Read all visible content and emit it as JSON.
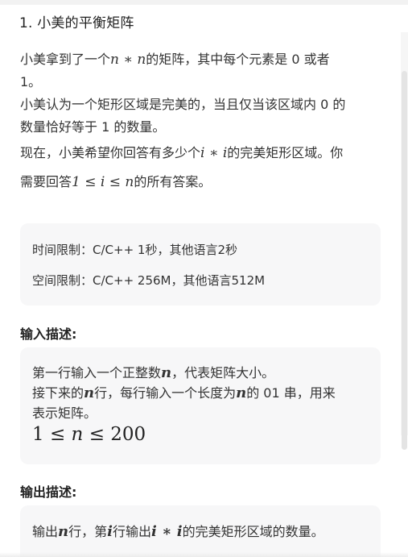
{
  "problem": {
    "title": "1. 小美的平衡矩阵",
    "description": {
      "line1_before": "小美拿到了一个",
      "line1_math": "n ∗ n",
      "line1_after": "的矩阵，其中每个元素是 0 或者",
      "line2": "1。",
      "line3": "小美认为一个矩形区域是完美的，当且仅当该区域内 0 的",
      "line4": "数量恰好等于 1 的数量。",
      "line5_before": "现在，小美希望你回答有多少个",
      "line5_math": "i ∗ i",
      "line5_after": "的完美矩形区域。你",
      "line6_before": "需要回答",
      "line6_math": "1 ≤ i ≤ n",
      "line6_after": "的所有答案。"
    },
    "limits": {
      "time": "时间限制：C/C++ 1秒，其他语言2秒",
      "memory": "空间限制：C/C++ 256M，其他语言512M"
    },
    "input": {
      "heading": "输入描述:",
      "line1_before": "第一行输入一个正整数",
      "line1_math": "n",
      "line1_after": "，代表矩阵大小。",
      "line2_before": "接下来的",
      "line2_math": "n",
      "line2_after": "行，每行输入一个长度为",
      "line2_math2": "n",
      "line2_after2": "的 01 串，用来",
      "line3": "表示矩阵。",
      "constraint_lo": "1",
      "constraint_var": "n",
      "constraint_hi": "200",
      "constraint_op": "≤"
    },
    "output": {
      "heading": "输出描述:",
      "line1_before": "输出",
      "line1_math": "n",
      "line1_mid": "行，第",
      "line1_math2": "i",
      "line1_mid2": "行输出",
      "line1_math3": "i ∗ i",
      "line1_after": "的完美矩形区域的数量。"
    }
  }
}
